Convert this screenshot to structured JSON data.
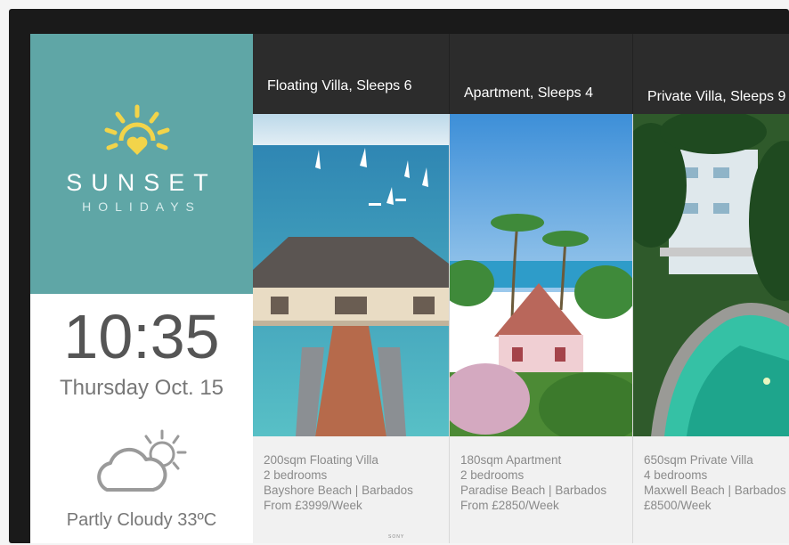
{
  "device": {
    "brand": "SONY"
  },
  "branding": {
    "name": "SUNSET",
    "tagline": "HOLIDAYS",
    "logo_icon": "sun-heart-logo-icon"
  },
  "clock": {
    "time": "10:35",
    "date": "Thursday Oct. 15"
  },
  "weather": {
    "icon": "partly-cloudy-icon",
    "label": "Partly Cloudy 33ºC"
  },
  "colors": {
    "brand_teal": "#5fa6a6",
    "logo_yellow": "#f2d44a",
    "header_dark": "#2c2c2c"
  },
  "listings": [
    {
      "title": "Floating Villa, Sleeps 6",
      "size": "200sqm Floating Villa",
      "bedrooms": "2 bedrooms",
      "location": "Bayshore Beach | Barbados",
      "price": "From £3999/Week",
      "photo": "floating-villa-over-water-photo"
    },
    {
      "title": "Apartment, Sleeps 4",
      "size": "180sqm Apartment",
      "bedrooms": "2 bedrooms",
      "location": "Paradise Beach | Barbados",
      "price": "From £2850/Week",
      "photo": "beach-apartment-with-palms-photo"
    },
    {
      "title": "Private Villa, Sleeps 9",
      "size": "650sqm Private Villa",
      "bedrooms": "4 bedrooms",
      "location": "Maxwell Beach | Barbados",
      "price": "£8500/Week",
      "photo": "private-villa-with-pool-photo"
    }
  ]
}
